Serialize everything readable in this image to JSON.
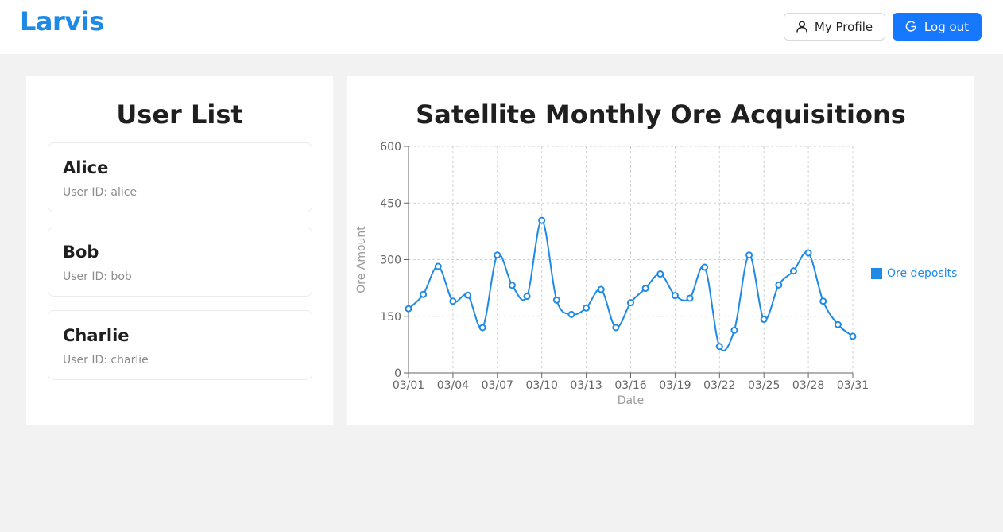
{
  "header": {
    "brand": "Larvis",
    "profile_label": "My Profile",
    "logout_label": "Log out",
    "accent_color": "#1677ff"
  },
  "users": {
    "title": "User List",
    "items": [
      {
        "name": "Alice",
        "id_text": "User ID: alice"
      },
      {
        "name": "Bob",
        "id_text": "User ID: bob"
      },
      {
        "name": "Charlie",
        "id_text": "User ID: charlie"
      }
    ]
  },
  "chart": {
    "title": "Satellite Monthly Ore Acquisitions",
    "legend_label": "Ore deposits"
  },
  "chart_data": {
    "type": "line",
    "title": "Satellite Monthly Ore Acquisitions",
    "xlabel": "Date",
    "ylabel": "Ore Amount",
    "ylim": [
      0,
      600
    ],
    "yticks": [
      0,
      150,
      300,
      450,
      600
    ],
    "xticks": [
      "03/01",
      "03/04",
      "03/07",
      "03/10",
      "03/13",
      "03/16",
      "03/19",
      "03/22",
      "03/25",
      "03/28",
      "03/31"
    ],
    "grid": true,
    "legend_position": "right",
    "color": "#1f8ae6",
    "x": [
      "03/01",
      "03/02",
      "03/03",
      "03/04",
      "03/05",
      "03/06",
      "03/07",
      "03/08",
      "03/09",
      "03/10",
      "03/11",
      "03/12",
      "03/13",
      "03/14",
      "03/15",
      "03/16",
      "03/17",
      "03/18",
      "03/19",
      "03/20",
      "03/21",
      "03/22",
      "03/23",
      "03/24",
      "03/25",
      "03/26",
      "03/27",
      "03/28",
      "03/29",
      "03/30",
      "03/31"
    ],
    "series": [
      {
        "name": "Ore deposits",
        "values": [
          170,
          208,
          282,
          190,
          206,
          120,
          312,
          232,
          203,
          404,
          193,
          155,
          172,
          221,
          120,
          186,
          224,
          262,
          205,
          198,
          280,
          70,
          113,
          312,
          142,
          233,
          270,
          318,
          190,
          128,
          97
        ]
      }
    ]
  }
}
